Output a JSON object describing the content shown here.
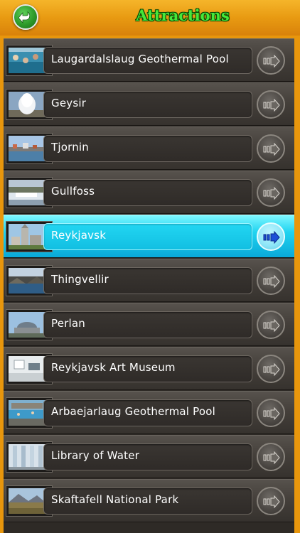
{
  "header": {
    "title": "Attractions",
    "back_icon": "back-arrow-icon"
  },
  "colors": {
    "header_bg": "#e89a12",
    "title_green": "#46e83a",
    "row_bg": "#45403b",
    "selected_bg": "#1fd3f0"
  },
  "selected_index": 4,
  "items": [
    {
      "label": "Laugardalslaug Geothermal Pool",
      "thumb": "pool"
    },
    {
      "label": "Geysir",
      "thumb": "geyser"
    },
    {
      "label": "Tjornin",
      "thumb": "lake-city"
    },
    {
      "label": "Gullfoss",
      "thumb": "waterfall"
    },
    {
      "label": "Reykjavsk",
      "thumb": "church-town"
    },
    {
      "label": "Thingvellir",
      "thumb": "river-rocks"
    },
    {
      "label": "Perlan",
      "thumb": "dome-building"
    },
    {
      "label": "Reykjavsk Art Museum",
      "thumb": "gallery"
    },
    {
      "label": "Arbaejarlaug Geothermal Pool",
      "thumb": "outdoor-pool"
    },
    {
      "label": "Library of Water",
      "thumb": "glass-columns"
    },
    {
      "label": "Skaftafell National Park",
      "thumb": "mountain-field"
    }
  ]
}
